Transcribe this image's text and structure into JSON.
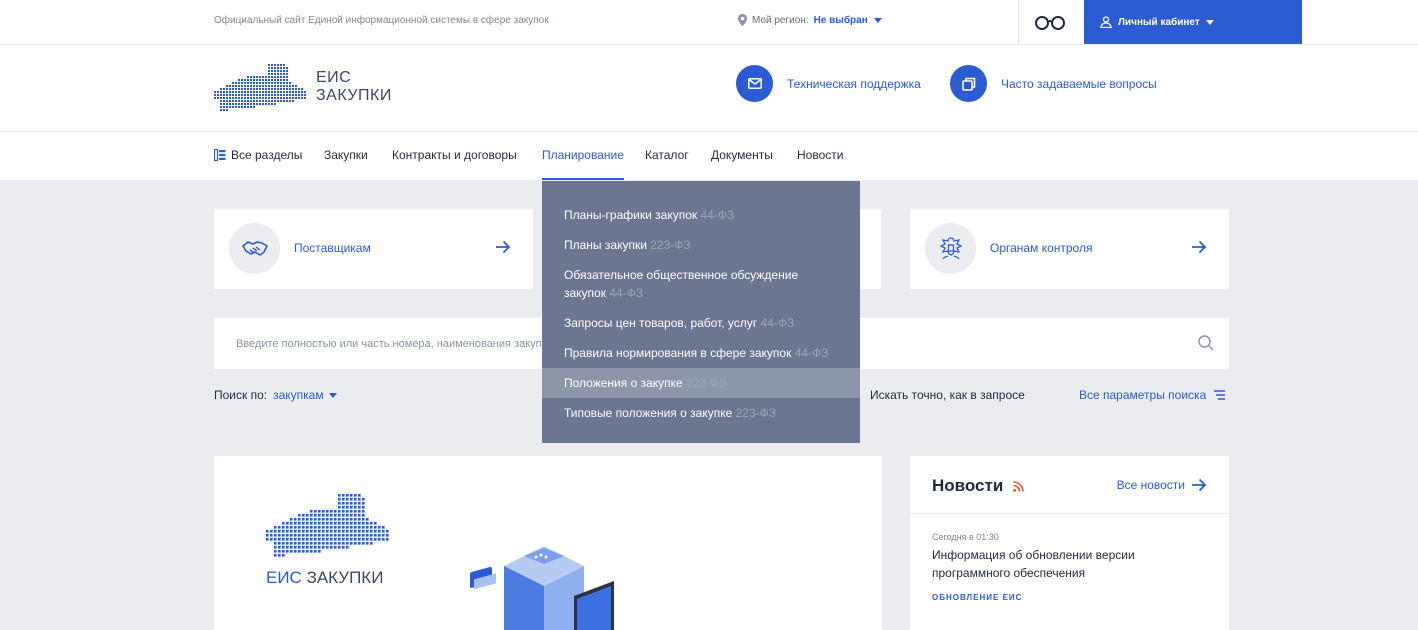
{
  "topbar": {
    "site_title": "Официальный сайт Единой информационной системы в сфере закупок",
    "region_label": "Мой регион:",
    "region_value": "Не выбран",
    "cabinet_label": "Личный кабинет",
    "icons": {
      "region": "location-pin-icon",
      "glasses": "glasses-icon",
      "cabinet": "user-icon"
    }
  },
  "header": {
    "logo_line1": "ЕИС",
    "logo_line2": "ЗАКУПКИ",
    "support_label": "Техническая поддержка",
    "faq_label": "Часто задаваемые вопросы"
  },
  "nav": {
    "items": [
      {
        "label": "Все разделы"
      },
      {
        "label": "Закупки"
      },
      {
        "label": "Контракты и договоры"
      },
      {
        "label": "Планирование",
        "active": true
      },
      {
        "label": "Каталог"
      },
      {
        "label": "Документы"
      },
      {
        "label": "Новости"
      }
    ]
  },
  "dropdown": {
    "items": [
      {
        "label": "Планы-графики закупок",
        "law": "44-ФЗ"
      },
      {
        "label": "Планы закупки",
        "law": "223-ФЗ"
      },
      {
        "label": "Обязательное общественное обсуждение закупок",
        "law": "44-ФЗ"
      },
      {
        "label": "Запросы цен товаров, работ, услуг",
        "law": "44-ФЗ"
      },
      {
        "label": "Правила нормирования в сфере закупок",
        "law": "44-ФЗ"
      },
      {
        "label": "Положения о закупке",
        "law": "223-ФЗ",
        "highlighted": true
      },
      {
        "label": "Типовые положения о закупке",
        "law": "223-ФЗ"
      }
    ]
  },
  "cards": {
    "suppliers": "Поставщикам",
    "control": "Органам контроля"
  },
  "search": {
    "placeholder": "Введите полностью или часть номера, наименования закупки, наименования или ИНН Заказчика",
    "search_by_label": "Поиск по:",
    "search_by_value": "закупкам",
    "exact_label": "Искать точно, как в запросе",
    "all_params_label": "Все параметры поиска"
  },
  "banner": {
    "logo_text_1": "ЕИС",
    "logo_text_2": "ЗАКУПКИ"
  },
  "news": {
    "title": "Новости",
    "all_label": "Все новости",
    "items": [
      {
        "date": "Сегодня в 01:30",
        "text": "Информация об обновлении версии программного обеспечения",
        "tag": "ОБНОВЛЕНИЕ ЕИС"
      }
    ]
  },
  "colors": {
    "accent": "#2c5bd3",
    "dropdown_bg": "#6c7690",
    "page_bg": "#ebecef"
  }
}
